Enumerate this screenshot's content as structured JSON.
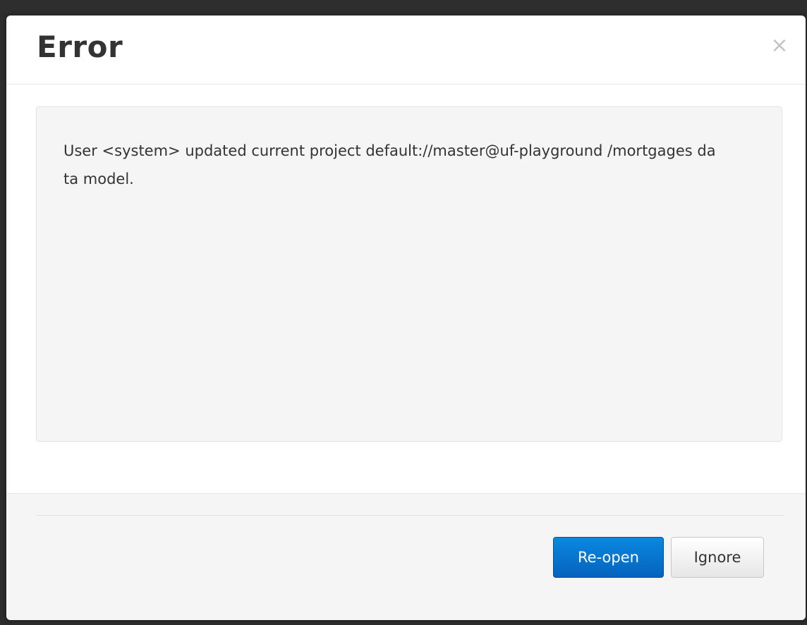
{
  "dialog": {
    "title": "Error",
    "close_glyph": "×",
    "message": "User <system> updated current project default://master@uf-playground /mortgages data model.",
    "buttons": {
      "reopen_label": "Re-open",
      "ignore_label": "Ignore"
    }
  },
  "colors": {
    "primary_button": "#0563bd",
    "body_well": "#f5f5f5",
    "title_text": "#333333"
  },
  "icons": {
    "close": "close-icon"
  }
}
